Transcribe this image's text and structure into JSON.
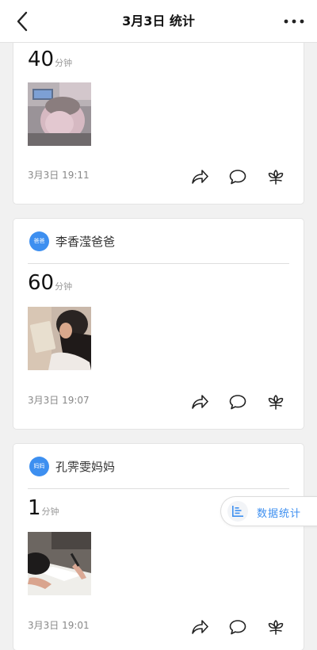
{
  "header": {
    "title": "3月3日 统计",
    "back_icon": "chevron-left-icon",
    "more_icon": "more-horizontal-icon"
  },
  "posts": [
    {
      "user": "",
      "avatar_label": "",
      "duration_value": "40",
      "duration_unit": "分钟",
      "photo": "child-in-pink-hooded-jacket",
      "time": "3月3日 19:11"
    },
    {
      "user": "李香滢爸爸",
      "avatar_label": "爸爸",
      "duration_value": "60",
      "duration_unit": "分钟",
      "photo": "child-reading-book",
      "time": "3月3日 19:07"
    },
    {
      "user": "孔霁雯妈妈",
      "avatar_label": "妈妈",
      "duration_value": "1",
      "duration_unit": "分钟",
      "photo": "child-writing-at-desk",
      "time": "3月3日 19:01"
    }
  ],
  "actions": {
    "share_icon": "share-arrow-icon",
    "comment_icon": "comment-bubble-icon",
    "like_icon": "flower-like-icon"
  },
  "float_button": {
    "label": "数据统计",
    "icon": "bar-list-icon"
  },
  "colors": {
    "accent": "#3d8ff0",
    "background": "#f1f1f1",
    "card": "#ffffff"
  }
}
